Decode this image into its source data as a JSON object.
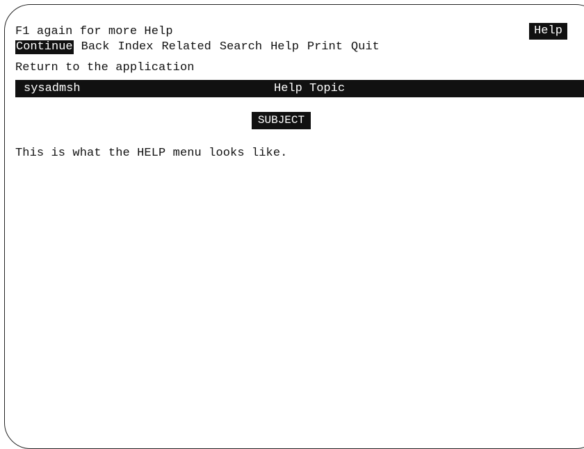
{
  "header": {
    "hint": "F1 again for more Help",
    "badge": "Help"
  },
  "menu": {
    "items": [
      {
        "label": "Continue",
        "selected": true
      },
      {
        "label": "Back",
        "selected": false
      },
      {
        "label": "Index",
        "selected": false
      },
      {
        "label": "Related",
        "selected": false
      },
      {
        "label": "Search",
        "selected": false
      },
      {
        "label": "Help",
        "selected": false
      },
      {
        "label": "Print",
        "selected": false
      },
      {
        "label": "Quit",
        "selected": false
      }
    ]
  },
  "status": {
    "description": "Return to the application"
  },
  "titlebar": {
    "app_name": "sysadmsh",
    "topic": "Help Topic"
  },
  "content": {
    "subject": "SUBJECT",
    "body": "This is what the HELP menu looks like."
  }
}
